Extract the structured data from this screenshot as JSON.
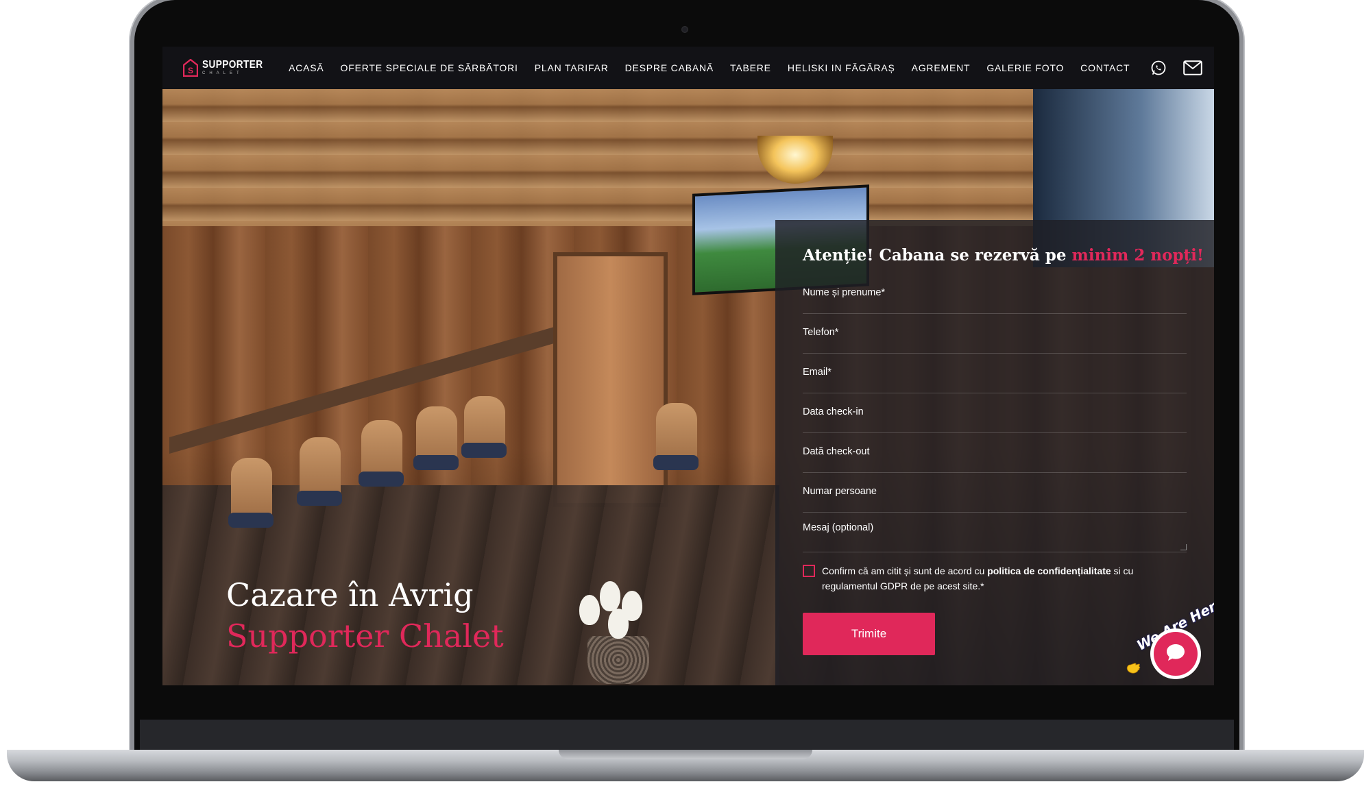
{
  "brand": {
    "name": "SUPPORTER",
    "sub": "CHALET"
  },
  "nav": {
    "items": [
      "ACASĂ",
      "OFERTE SPECIALE DE SĂRBĂTORI",
      "PLAN TARIFAR",
      "DESPRE CABANĂ",
      "TABERE",
      "HELISKI IN FĂGĂRAȘ",
      "AGREMENT",
      "GALERIE FOTO",
      "CONTACT"
    ],
    "icons": [
      "whatsapp-icon",
      "mail-icon"
    ]
  },
  "hero": {
    "title_line1": "Cazare în Avrig",
    "title_line2": "Supporter Chalet"
  },
  "form": {
    "heading_prefix": "Atenție! Cabana se rezervă pe ",
    "heading_accent": "minim 2 nopți!",
    "fields": {
      "name": "Nume și prenume*",
      "phone": "Telefon*",
      "email": "Email*",
      "checkin": "Data check-in",
      "checkout": "Dată check-out",
      "persons": "Numar persoane",
      "message": "Mesaj (optional)"
    },
    "consent_prefix": "Confirm că am citit și sunt de acord cu ",
    "consent_link": "politica de confidențialitate",
    "consent_suffix": " si cu regulamentul GDPR de pe acest site.*",
    "submit": "Trimite"
  },
  "chat": {
    "label": "We Are Here!"
  },
  "colors": {
    "accent": "#e0285a",
    "nav_bg": "#121216",
    "panel_bg": "#1e1e24"
  }
}
